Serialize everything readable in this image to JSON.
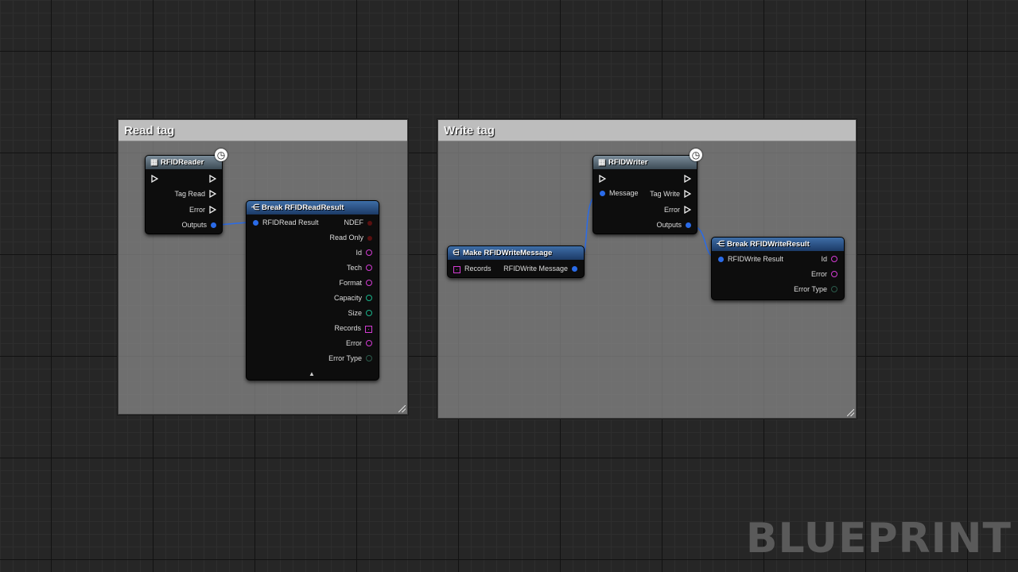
{
  "comments": {
    "read": {
      "title": "Read tag"
    },
    "write": {
      "title": "Write tag"
    }
  },
  "nodes": {
    "rfid_reader": {
      "title": "RFIDReader",
      "outputs": [
        "Tag Read",
        "Error",
        "Outputs"
      ]
    },
    "break_read": {
      "title": "Break RFIDReadResult",
      "input": "RFIDRead Result",
      "outputs": [
        "NDEF",
        "Read Only",
        "Id",
        "Tech",
        "Format",
        "Capacity",
        "Size",
        "Records",
        "Error",
        "Error Type"
      ]
    },
    "rfid_writer": {
      "title": "RFIDWriter",
      "input": "Message",
      "outputs": [
        "Tag Write",
        "Error",
        "Outputs"
      ]
    },
    "make_write": {
      "title": "Make RFIDWriteMessage",
      "input": "Records",
      "output": "RFIDWrite Message"
    },
    "break_write": {
      "title": "Break RFIDWriteResult",
      "input": "RFIDWrite Result",
      "outputs": [
        "Id",
        "Error",
        "Error Type"
      ]
    }
  },
  "icons": {
    "latent": "clock-icon",
    "struct_fn": "break-struct-icon",
    "variable": "variable-icon"
  },
  "colors": {
    "struct_pin": "#2a6be8",
    "string_pin": "#d33bd3",
    "int_pin": "#19b38a",
    "bool_pin": "#5a1010"
  },
  "watermark": "BLUEPRINT"
}
